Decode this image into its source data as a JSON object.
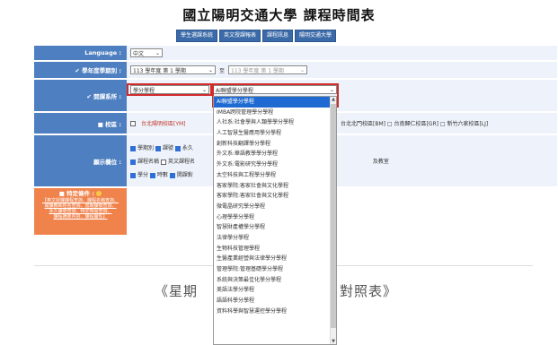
{
  "page_title": "國立陽明交通大學 課程時間表",
  "top_nav": [
    "學生選課系統",
    "英文授課報表",
    "課程訊息",
    "陽明交通大學"
  ],
  "language": {
    "label": "Language :",
    "value": "中文"
  },
  "semester": {
    "label": "✔ 學年度學期別 :",
    "from": "113 學年度 第 1 學期",
    "to_word": "至",
    "to": "113 學年度 第 1 學期"
  },
  "dept": {
    "label": "✔ 開課系所 :",
    "category_value": "學分學程",
    "program_value": "AI聯盟學分學程"
  },
  "campus": {
    "label": "■ 校區 :",
    "left_option": "台北陽明校區[YM]",
    "right_text": "台北北門校區[BM] □ 台南歸仁校區[GR] □ 新竹六家校區[LJ]"
  },
  "display": {
    "label": "顯示欄位 :",
    "row1": [
      "學期別",
      "課號",
      "永久"
    ],
    "row2": [
      "課程名稱",
      "英文課程名"
    ],
    "row2_tail": "及教室",
    "row3": [
      "學分",
      "時數",
      "開課對"
    ]
  },
  "special": {
    "header": "■ 特定條件 :",
    "links": [
      "【英文授課課程查詢、課程名稱查詢、",
      "開課教師姓名查詢、當期課號查詢、",
      "永久課號查詢、特定時間查詢、",
      "課程摘要內容、課程屬性】"
    ]
  },
  "weekday_left": "《星期",
  "weekday_right": "對照表》",
  "dropdown_items": [
    "AI聯盟學分學程",
    "IMBA跨院管理學分學程",
    "人社系:社會學與人類學學分學程",
    "人工智慧生醫應用學分學程",
    "創新科技翻譯學分學程",
    "外文系:華語教學學分學程",
    "外文系:電影研究學分學程",
    "太空科技與工程學分學程",
    "客家學院:客家社會與文化學程",
    "客家學院:客家社會與文化學程",
    "微電晶研究學分學程",
    "心理學學分學程",
    "智慧財產權學分學程",
    "法律學分學程",
    "生物科技管理學程",
    "生醫產業經營與法律學分學程",
    "管理學院:管理基礎學分學程",
    "系統與決策最佳化學分學程",
    "美語法學分學程",
    "語語科學分學程",
    "資料科學與智慧運控學分學程"
  ]
}
